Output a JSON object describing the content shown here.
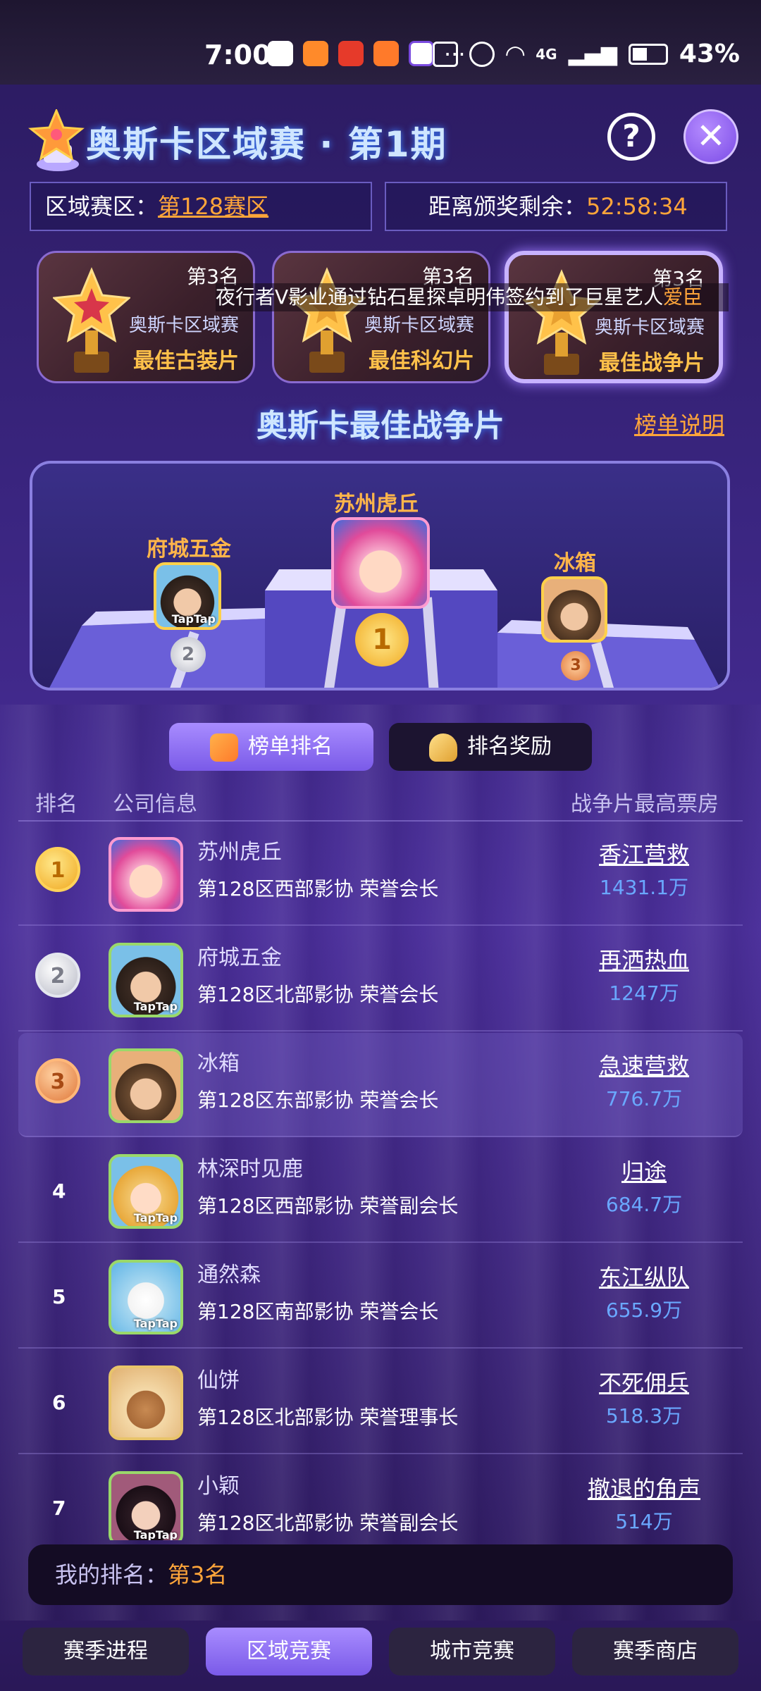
{
  "status_bar": {
    "time": "7:00",
    "signal": "4G",
    "battery": "43%",
    "more": "···"
  },
  "header": {
    "title": "奥斯卡区域赛 · 第1期"
  },
  "info": {
    "zone_label": "区域赛区：",
    "zone_value": "第128赛区",
    "countdown_label": "距离颁奖剩余：",
    "countdown_value": "52:58:34"
  },
  "ticker": {
    "text_main": "夜行者V影业通过钻石星探卓明伟签约到了巨星艺人",
    "text_highlight": "爱臣"
  },
  "award_cards": [
    {
      "rank": "第3名",
      "competition": "奥斯卡区域赛",
      "category": "最佳古装片"
    },
    {
      "rank": "第3名",
      "competition": "奥斯卡区域赛",
      "category": "最佳科幻片"
    },
    {
      "rank": "第3名",
      "competition": "奥斯卡区域赛",
      "category": "最佳战争片"
    }
  ],
  "section": {
    "title": "奥斯卡最佳战争片",
    "rules_link": "榜单说明"
  },
  "podium": {
    "first": "苏州虎丘",
    "second": "府城五金",
    "third": "冰箱",
    "first_medal": "1",
    "second_medal": "2",
    "third_medal": "3"
  },
  "tabs": {
    "ranking": "榜单排名",
    "rewards": "排名奖励"
  },
  "columns": {
    "rank": "排名",
    "company": "公司信息",
    "box_office": "战争片最高票房"
  },
  "rows": [
    {
      "rank": "1",
      "name": "苏州虎丘",
      "sub": "第128区西部影协  荣誉会长",
      "film": "香江营救",
      "box": "1431.1万"
    },
    {
      "rank": "2",
      "name": "府城五金",
      "sub": "第128区北部影协  荣誉会长",
      "film": "再洒热血",
      "box": "1247万"
    },
    {
      "rank": "3",
      "name": "冰箱",
      "sub": "第128区东部影协  荣誉会长",
      "film": "急速营救",
      "box": "776.7万"
    },
    {
      "rank": "4",
      "name": "林深时见鹿",
      "sub": "第128区西部影协  荣誉副会长",
      "film": "归途",
      "box": "684.7万"
    },
    {
      "rank": "5",
      "name": "通然森",
      "sub": "第128区南部影协  荣誉会长",
      "film": "东江纵队",
      "box": "655.9万"
    },
    {
      "rank": "6",
      "name": "仙饼",
      "sub": "第128区北部影协  荣誉理事长",
      "film": "不死佣兵",
      "box": "518.3万"
    },
    {
      "rank": "7",
      "name": "小颖",
      "sub": "第128区北部影协  荣誉副会长",
      "film": "撤退的角声",
      "box": "514万"
    }
  ],
  "my_rank": {
    "label": "我的排名：",
    "value": "第3名"
  },
  "bottom_nav": [
    "赛季进程",
    "区域竞赛",
    "城市竞赛",
    "赛季商店"
  ],
  "misc": {
    "taptap": "TapTap",
    "help_glyph": "?",
    "close_glyph": "✕"
  },
  "colors": {
    "accent": "#ffa53a",
    "title_glow": "#cfe6ff",
    "box_office": "#6aa8ff",
    "active_tab": "#8f70f0"
  }
}
